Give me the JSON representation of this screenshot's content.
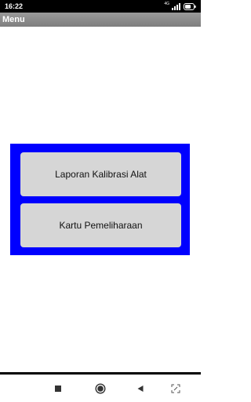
{
  "status_bar": {
    "time": "16:22",
    "network_label": "4G",
    "icons": [
      "signal-icon",
      "battery-icon"
    ]
  },
  "title_bar": {
    "title": "Menu"
  },
  "menu": {
    "panel_color": "#0000ff",
    "buttons": [
      {
        "label": "Laporan Kalibrasi Alat"
      },
      {
        "label": "Kartu Pemeliharaan"
      }
    ]
  },
  "nav_bar": {
    "icons": [
      "recent-apps-icon",
      "home-icon",
      "back-icon",
      "screenshot-icon"
    ]
  }
}
